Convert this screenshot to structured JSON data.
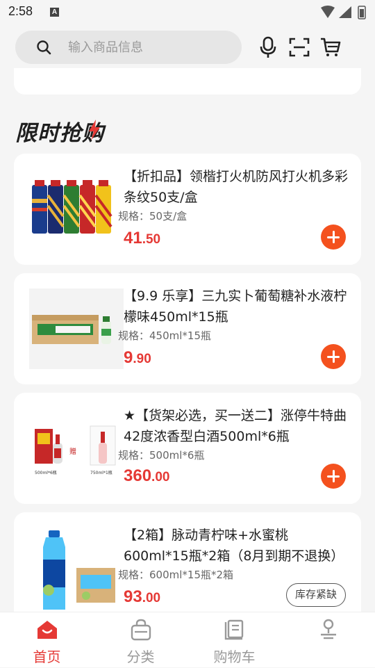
{
  "status_bar": {
    "time": "2:58",
    "notification_letter": "A"
  },
  "search": {
    "placeholder": "输入商品信息"
  },
  "section": {
    "title": "限时抢购"
  },
  "products": [
    {
      "title": "【折扣品】领楷打火机防风打火机多彩条纹50支/盒",
      "spec": "规格：50支/盒",
      "price_int": "41",
      "price_dec": ".50",
      "action": "add",
      "image": "lighters"
    },
    {
      "title": "【9.9 乐享】三九实卜葡萄糖补水液柠檬味450ml*15瓶",
      "spec": "规格：450ml*15瓶",
      "price_int": "9",
      "price_dec": ".90",
      "action": "add",
      "image": "drink-box"
    },
    {
      "title": "★【货架必选，买一送二】涨停牛特曲42度浓香型白酒500ml*6瓶",
      "spec": "规格：500ml*6瓶",
      "price_int": "360",
      "price_dec": ".00",
      "action": "add",
      "image": "liquor",
      "image_caption_1": "500ml*6瓶",
      "image_caption_2": "750ml*1瓶",
      "image_gift_mark": "赠"
    },
    {
      "title": "【2箱】脉动青柠味+水蜜桃600ml*15瓶*2箱（8月到期不退换）",
      "spec": "规格：600ml*15瓶*2箱",
      "price_int": "93",
      "price_dec": ".00",
      "action": "stock",
      "stock_label": "库存紧缺",
      "image": "mizone"
    }
  ],
  "tabs": [
    {
      "label": "首页",
      "icon": "home-icon",
      "active": true
    },
    {
      "label": "分类",
      "icon": "bag-icon",
      "active": false
    },
    {
      "label": "购物车",
      "icon": "cart-icon",
      "active": false
    },
    {
      "label": "",
      "icon": "user-icon",
      "active": false
    }
  ],
  "colors": {
    "accent": "#e53935",
    "add_button": "#f4511e",
    "background": "#f5f5f5"
  }
}
